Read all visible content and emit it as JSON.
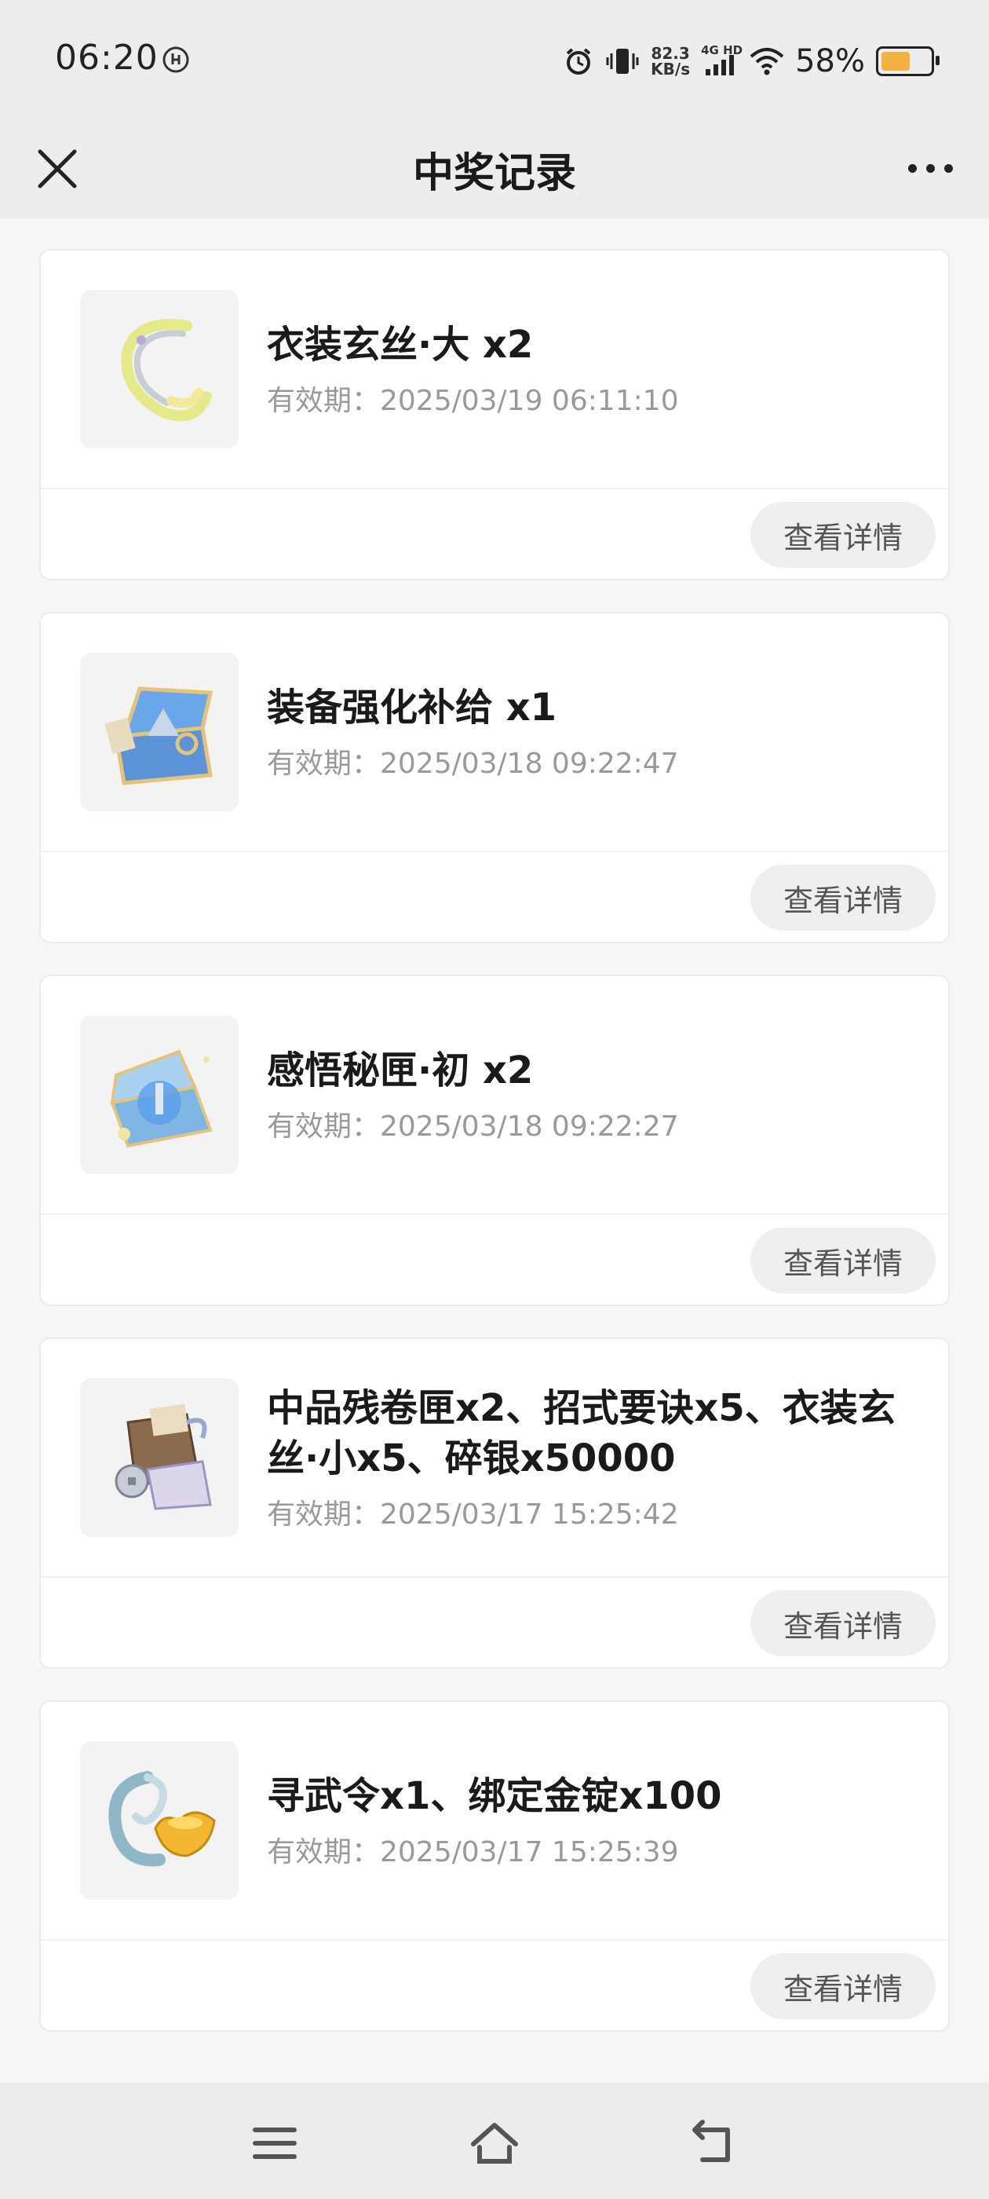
{
  "status_bar": {
    "time": "06:20",
    "net_speed_top": "82.3",
    "net_speed_bottom": "KB/s",
    "network": "4G HD",
    "battery_pct": "58%",
    "battery_level": 0.58,
    "icons": [
      "clock-badge-icon",
      "alarm-icon",
      "vibrate-icon",
      "signal-icon",
      "wifi-icon",
      "battery-icon"
    ]
  },
  "nav": {
    "title": "中奖记录",
    "close_icon": "close-icon",
    "more_icon": "more-icon"
  },
  "records": [
    {
      "name": "衣装玄丝·大 x2",
      "validity": "有效期：2025/03/19 06:11:10",
      "button": "查看详情",
      "icon": "silk-thread-icon"
    },
    {
      "name": "装备强化补给 x1",
      "validity": "有效期：2025/03/18 09:22:47",
      "button": "查看详情",
      "icon": "equipment-chest-icon"
    },
    {
      "name": "感悟秘匣·初 x2",
      "validity": "有效期：2025/03/18 09:22:27",
      "button": "查看详情",
      "icon": "insight-box-icon"
    },
    {
      "name": "中品残卷匣x2、招式要诀x5、衣装玄丝·小x5、碎银x50000",
      "validity": "有效期：2025/03/17 15:25:42",
      "button": "查看详情",
      "icon": "scroll-bundle-icon"
    },
    {
      "name": "寻武令x1、绑定金锭x100",
      "validity": "有效期：2025/03/17 15:25:39",
      "button": "查看详情",
      "icon": "token-gold-ingot-icon"
    }
  ],
  "bottom_nav": {
    "icons": [
      "menu-icon",
      "home-icon",
      "back-icon"
    ]
  },
  "colors": {
    "background": "#f6f6f6",
    "bar": "#ededed",
    "battery": "#f4b13f",
    "secondary_text": "#9a9a9a"
  }
}
